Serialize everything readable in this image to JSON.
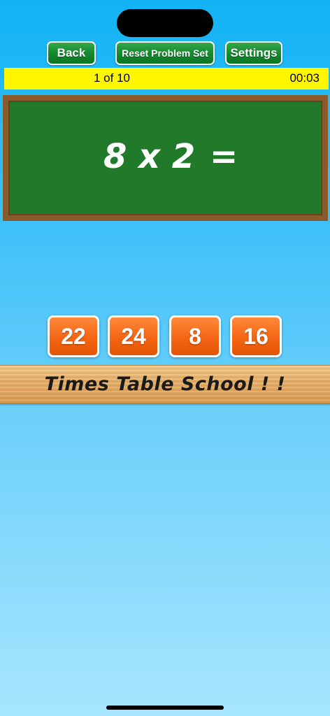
{
  "toolbar": {
    "back_label": "Back",
    "reset_label": "Reset Problem Set",
    "settings_label": "Settings"
  },
  "status": {
    "progress": "1 of 10",
    "timer": "00:03"
  },
  "problem": {
    "expression": "8 x 2",
    "equals": "="
  },
  "answers": [
    "22",
    "24",
    "8",
    "16"
  ],
  "banner": {
    "title": "Times Table School ! !"
  },
  "colors": {
    "background": "#12b3f4",
    "status_bar": "#fff700",
    "chalkboard": "#217a2a",
    "chalkboard_frame": "#8b5a2b",
    "toolbar_button": "#158a2e",
    "answer_button": "#f46514"
  }
}
